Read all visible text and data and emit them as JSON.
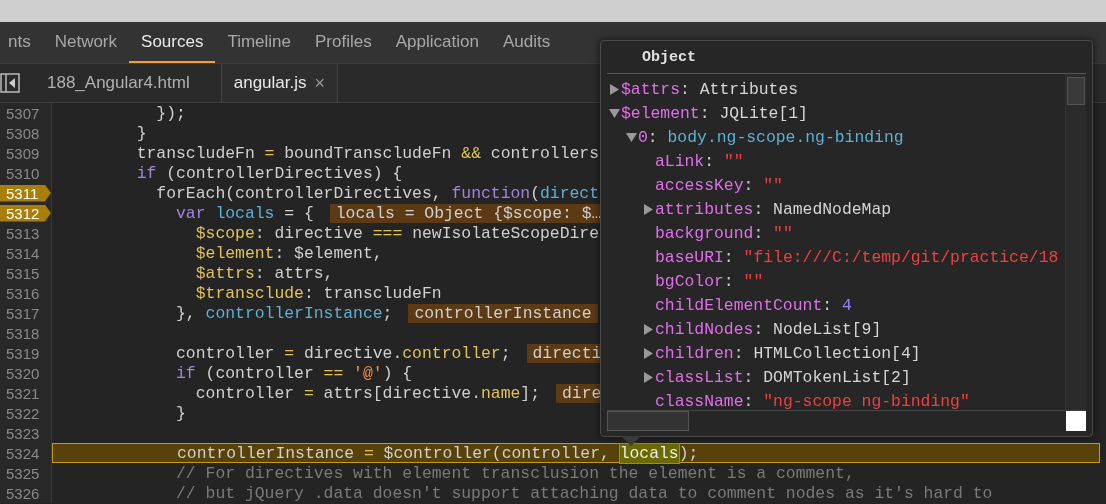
{
  "tabs": [
    {
      "label": "nts",
      "selected": false
    },
    {
      "label": "Network",
      "selected": false
    },
    {
      "label": "Sources",
      "selected": true
    },
    {
      "label": "Timeline",
      "selected": false
    },
    {
      "label": "Profiles",
      "selected": false
    },
    {
      "label": "Application",
      "selected": false
    },
    {
      "label": "Audits",
      "selected": false
    }
  ],
  "file_tabs": [
    {
      "label": "188_Angular4.html",
      "selected": false,
      "closable": false
    },
    {
      "label": "angular.js",
      "selected": true,
      "closable": true,
      "close": "×"
    }
  ],
  "lines": [
    {
      "n": "5307",
      "tokens": [
        {
          "t": "          });",
          "kind": "plain"
        }
      ],
      "breakpoint": false,
      "current": false
    },
    {
      "n": "5308",
      "tokens": [
        {
          "t": "        }",
          "kind": "plain"
        }
      ],
      "breakpoint": false,
      "current": false
    },
    {
      "n": "5309",
      "tokens": [
        {
          "t": "        transcludeFn ",
          "kind": "plain"
        },
        {
          "t": "=",
          "kind": "op"
        },
        {
          "t": " boundTranscludeFn ",
          "kind": "plain"
        },
        {
          "t": "&&",
          "kind": "op"
        },
        {
          "t": " controllers",
          "kind": "plain"
        }
      ],
      "breakpoint": false,
      "current": false
    },
    {
      "n": "5310",
      "tokens": [
        {
          "t": "        if",
          "kind": "keyword"
        },
        {
          "t": " (controllerDirectives) {",
          "kind": "plain"
        }
      ],
      "breakpoint": false,
      "current": false
    },
    {
      "n": "5311",
      "tokens": [
        {
          "t": "          forEach(controllerDirectives, ",
          "kind": "plain"
        },
        {
          "t": "function",
          "kind": "keyword"
        },
        {
          "t": "(",
          "kind": "plain"
        },
        {
          "t": "direct",
          "kind": "def"
        }
      ],
      "breakpoint": true,
      "current": false
    },
    {
      "n": "5312",
      "tokens": [
        {
          "t": "            var ",
          "kind": "keyword"
        },
        {
          "t": "locals",
          "kind": "def"
        },
        {
          "t": " = {",
          "kind": "plain"
        }
      ],
      "inline": "locals = Object {$scope: $…",
      "breakpoint": true,
      "current": false
    },
    {
      "n": "5313",
      "tokens": [
        {
          "t": "              $scope",
          "kind": "prop"
        },
        {
          "t": ": directive ",
          "kind": "plain"
        },
        {
          "t": "===",
          "kind": "op"
        },
        {
          "t": " newIsolateScopeDire",
          "kind": "plain"
        }
      ],
      "breakpoint": false,
      "current": false
    },
    {
      "n": "5314",
      "tokens": [
        {
          "t": "              $element",
          "kind": "prop"
        },
        {
          "t": ": $element,",
          "kind": "plain"
        }
      ],
      "breakpoint": false,
      "current": false
    },
    {
      "n": "5315",
      "tokens": [
        {
          "t": "              $attrs",
          "kind": "prop"
        },
        {
          "t": ": attrs,",
          "kind": "plain"
        }
      ],
      "breakpoint": false,
      "current": false
    },
    {
      "n": "5316",
      "tokens": [
        {
          "t": "              $transclude",
          "kind": "prop"
        },
        {
          "t": ": transcludeFn",
          "kind": "plain"
        }
      ],
      "breakpoint": false,
      "current": false
    },
    {
      "n": "5317",
      "tokens": [
        {
          "t": "            }, ",
          "kind": "plain"
        },
        {
          "t": "controllerInstance",
          "kind": "def"
        },
        {
          "t": ";",
          "kind": "plain"
        }
      ],
      "inline": "controllerInstance",
      "breakpoint": false,
      "current": false
    },
    {
      "n": "5318",
      "breakpoint": false,
      "current": false
    },
    {
      "n": "5319",
      "tokens": [
        {
          "t": "            controller ",
          "kind": "plain"
        },
        {
          "t": "=",
          "kind": "op"
        },
        {
          "t": " directive.",
          "kind": "plain"
        },
        {
          "t": "controller",
          "kind": "prop"
        },
        {
          "t": ";",
          "kind": "plain"
        }
      ],
      "inline": "directi",
      "breakpoint": false,
      "current": false
    },
    {
      "n": "5320",
      "tokens": [
        {
          "t": "            if",
          "kind": "keyword"
        },
        {
          "t": " (controller ",
          "kind": "plain"
        },
        {
          "t": "==",
          "kind": "op"
        },
        {
          "t": " '@'",
          "kind": "string"
        },
        {
          "t": ") {",
          "kind": "plain"
        }
      ],
      "breakpoint": false,
      "current": false
    },
    {
      "n": "5321",
      "tokens": [
        {
          "t": "              controller ",
          "kind": "plain"
        },
        {
          "t": "=",
          "kind": "op"
        },
        {
          "t": " attrs[directive.",
          "kind": "plain"
        },
        {
          "t": "name",
          "kind": "prop"
        },
        {
          "t": "];",
          "kind": "plain"
        }
      ],
      "inline": "dire",
      "breakpoint": false,
      "current": false
    },
    {
      "n": "5322",
      "tokens": [
        {
          "t": "            }",
          "kind": "plain"
        }
      ],
      "breakpoint": false,
      "current": false
    },
    {
      "n": "5323",
      "breakpoint": false,
      "current": false
    },
    {
      "n": "5324",
      "tokens": [
        {
          "t": "            controllerInstance ",
          "kind": "plain"
        },
        {
          "t": "=",
          "kind": "op"
        },
        {
          "t": " $controller(controller, ",
          "kind": "plain"
        },
        {
          "t": "locals",
          "kind": "hover"
        },
        {
          "t": ");",
          "kind": "plain"
        }
      ],
      "breakpoint": false,
      "current": true
    },
    {
      "n": "5325",
      "tokens": [
        {
          "t": "            // For directives with element transclusion the element is a comment,",
          "kind": "comment"
        }
      ],
      "breakpoint": false,
      "current": false
    },
    {
      "n": "5326",
      "tokens": [
        {
          "t": "            // but jQuery .data doesn't support attaching data to comment nodes as it's hard to",
          "kind": "comment"
        }
      ],
      "breakpoint": false,
      "current": false
    }
  ],
  "popover": {
    "title": "Object",
    "tree": [
      {
        "name": "$attrs",
        "sep": ":",
        "value": "Attributes",
        "kind": "object",
        "expanded": false
      },
      {
        "name": "$element",
        "sep": ":",
        "value": "JQLite[1]",
        "kind": "object",
        "expanded": true,
        "children": [
          {
            "name": "0",
            "sep": ":",
            "value": "body.ng-scope.ng-binding",
            "kind": "node",
            "expanded": true,
            "children": [
              {
                "name": "aLink",
                "sep": ":",
                "value": "\"\"",
                "kind": "string"
              },
              {
                "name": "accessKey",
                "sep": ":",
                "value": "\"\"",
                "kind": "string"
              },
              {
                "name": "attributes",
                "sep": ":",
                "value": "NamedNodeMap",
                "kind": "object",
                "expanded": false
              },
              {
                "name": "background",
                "sep": ":",
                "value": "\"\"",
                "kind": "string"
              },
              {
                "name": "baseURI",
                "sep": ":",
                "value": "\"file:///C:/temp/git/practice/18",
                "kind": "string"
              },
              {
                "name": "bgColor",
                "sep": ":",
                "value": "\"\"",
                "kind": "string"
              },
              {
                "name": "childElementCount",
                "sep": ":",
                "value": "4",
                "kind": "number"
              },
              {
                "name": "childNodes",
                "sep": ":",
                "value": "NodeList[9]",
                "kind": "object",
                "expanded": false
              },
              {
                "name": "children",
                "sep": ":",
                "value": "HTMLCollection[4]",
                "kind": "object",
                "expanded": false
              },
              {
                "name": "classList",
                "sep": ":",
                "value": "DOMTokenList[2]",
                "kind": "object",
                "expanded": false
              },
              {
                "name": "className",
                "sep": ":",
                "value": "\"ng-scope ng-binding\"",
                "kind": "string"
              }
            ]
          }
        ]
      }
    ]
  }
}
